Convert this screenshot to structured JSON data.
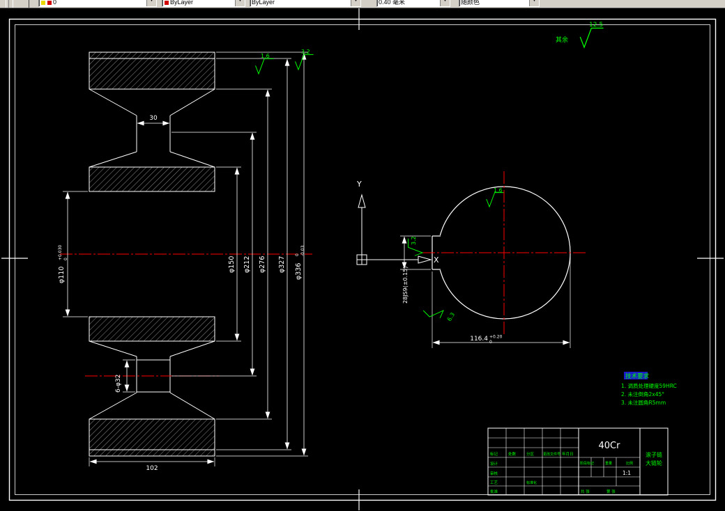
{
  "toolbar": {
    "layer_value": "0",
    "color_value": "ByLayer",
    "linetype_value": "ByLayer",
    "lineweight_value": "0.40 毫米",
    "plotstyle_value": "随颜色"
  },
  "drawing": {
    "left_view": {
      "dim_web_width": "30",
      "dim_total_width": "102",
      "dim_bore": "φ110",
      "dim_bore_tol_upper": "+0.030",
      "dim_bore_tol_lower": "0",
      "dim_hub": "φ150",
      "dim_bolt_circle": "φ212",
      "dim_rim_inner": "φ276",
      "dim_root": "φ327",
      "dim_outer": "φ336",
      "dim_outer_tol_upper": "0",
      "dim_outer_tol_lower": "-0.03",
      "dim_holes": "6-φ32",
      "roughness_face": "1.6",
      "roughness_rim": "3.2"
    },
    "right_view": {
      "dim_keyway_width": "28JS9(±0.15)",
      "dim_keyway_depth": "116.4",
      "dim_keyway_depth_tol_upper": "+0.20",
      "dim_keyway_depth_tol_lower": "0",
      "roughness_bore": "1.6",
      "roughness_keyway_side": "3.2",
      "roughness_keyway_bottom": "6.3"
    },
    "ucs": {
      "x_label": "X",
      "y_label": "Y"
    },
    "general_roughness": {
      "prefix": "其余",
      "value": "12.5"
    },
    "notes": {
      "title": "技术要求",
      "items": [
        "1. 调质处理硬度59HRC",
        "2. 未注倒角2x45°",
        "3. 未注圆角R5mm"
      ]
    },
    "title_block": {
      "material": "40Cr",
      "name_line1": "滚子链",
      "name_line2": "大链轮",
      "header_labels": [
        "标记",
        "处数",
        "分区",
        "更改文件号",
        "年月日"
      ],
      "sign_labels": [
        "设计",
        "审核",
        "工艺",
        "批准"
      ],
      "std_label": "标准化",
      "stage_label": "阶段标记",
      "weight_label": "重量",
      "scale_label": "比例",
      "scale_value": "1:1",
      "sheet_total": "共 张",
      "sheet_page": "第 张"
    }
  },
  "colors": {
    "accent_green": "#00ff00",
    "centerline_red": "#ff0000",
    "line_white": "#ffffff"
  }
}
